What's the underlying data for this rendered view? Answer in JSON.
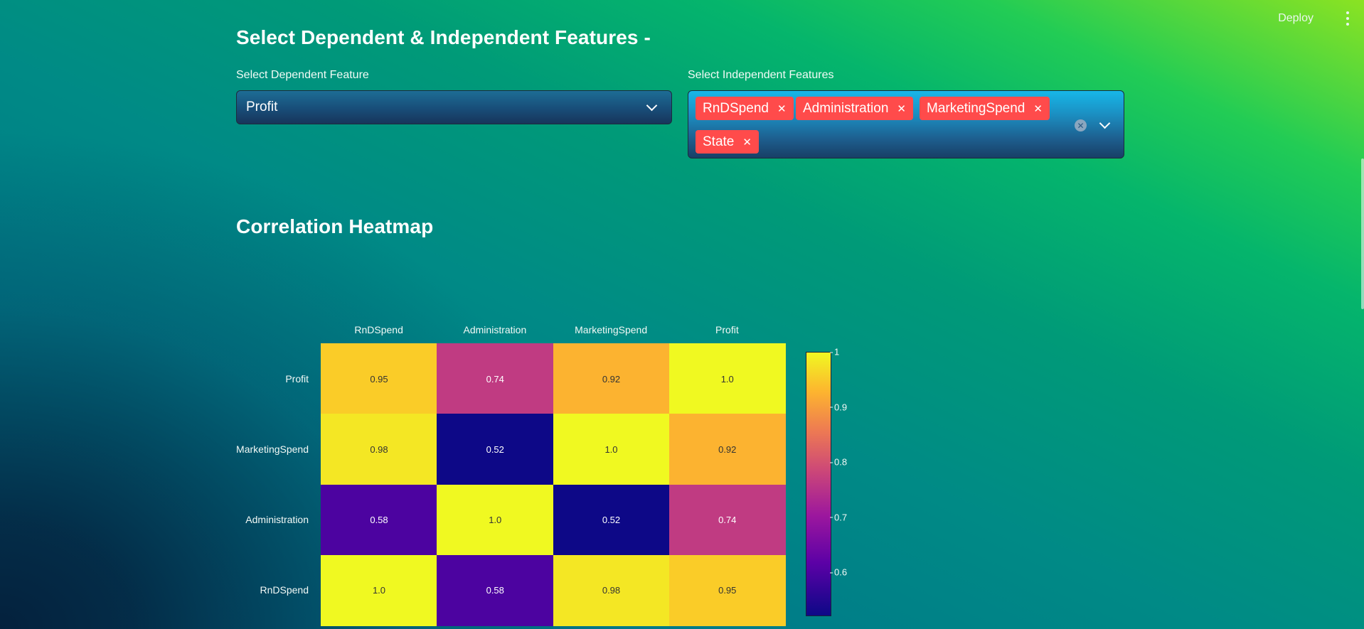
{
  "header": {
    "deploy_label": "Deploy",
    "menu_icon": "kebab-menu-icon"
  },
  "features_section": {
    "title": "Select Dependent & Independent Features -",
    "dependent": {
      "label": "Select Dependent Feature",
      "value": "Profit"
    },
    "independent": {
      "label": "Select Independent Features",
      "tags": [
        "RnDSpend",
        "Administration",
        "MarketingSpend",
        "State"
      ]
    }
  },
  "heatmap_section": {
    "title": "Correlation Heatmap"
  },
  "chart_data": {
    "type": "heatmap",
    "colormap": "plasma",
    "x_labels": [
      "RnDSpend",
      "Administration",
      "MarketingSpend",
      "Profit"
    ],
    "y_labels": [
      "Profit",
      "MarketingSpend",
      "Administration",
      "RnDSpend"
    ],
    "values": [
      [
        0.95,
        0.74,
        0.92,
        1.0
      ],
      [
        0.98,
        0.52,
        1.0,
        0.92
      ],
      [
        0.58,
        1.0,
        0.52,
        0.74
      ],
      [
        1.0,
        0.58,
        0.98,
        0.95
      ]
    ],
    "display_values": [
      [
        "0.95",
        "0.74",
        "0.92",
        "1.0"
      ],
      [
        "0.98",
        "0.52",
        "1.0",
        "0.92"
      ],
      [
        "0.58",
        "1.0",
        "0.52",
        "0.74"
      ],
      [
        "1.0",
        "0.58",
        "0.98",
        "0.95"
      ]
    ],
    "zmin": 0.52,
    "zmax": 1.0,
    "colorbar_ticks": [
      {
        "value": 1.0,
        "label": "1"
      },
      {
        "value": 0.9,
        "label": "0.9"
      },
      {
        "value": 0.8,
        "label": "0.8"
      },
      {
        "value": 0.7,
        "label": "0.7"
      },
      {
        "value": 0.6,
        "label": "0.6"
      }
    ]
  }
}
